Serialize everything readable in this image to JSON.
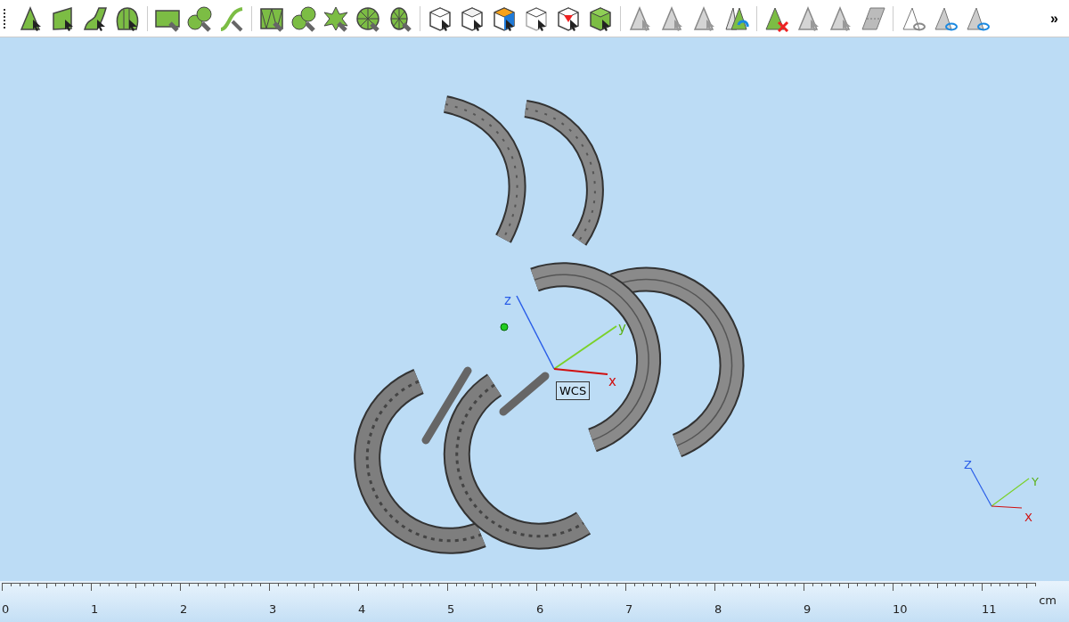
{
  "toolbar": {
    "overflow": "»"
  },
  "viewport": {
    "wcs": {
      "label": "WCS",
      "x": "x",
      "y": "y",
      "z": "z"
    },
    "triad": {
      "x": "X",
      "y": "Y",
      "z": "Z"
    }
  },
  "ruler": {
    "labels": [
      "0",
      "1",
      "2",
      "3",
      "4",
      "5",
      "6",
      "7",
      "8",
      "9",
      "10",
      "11"
    ],
    "unit": "cm"
  }
}
